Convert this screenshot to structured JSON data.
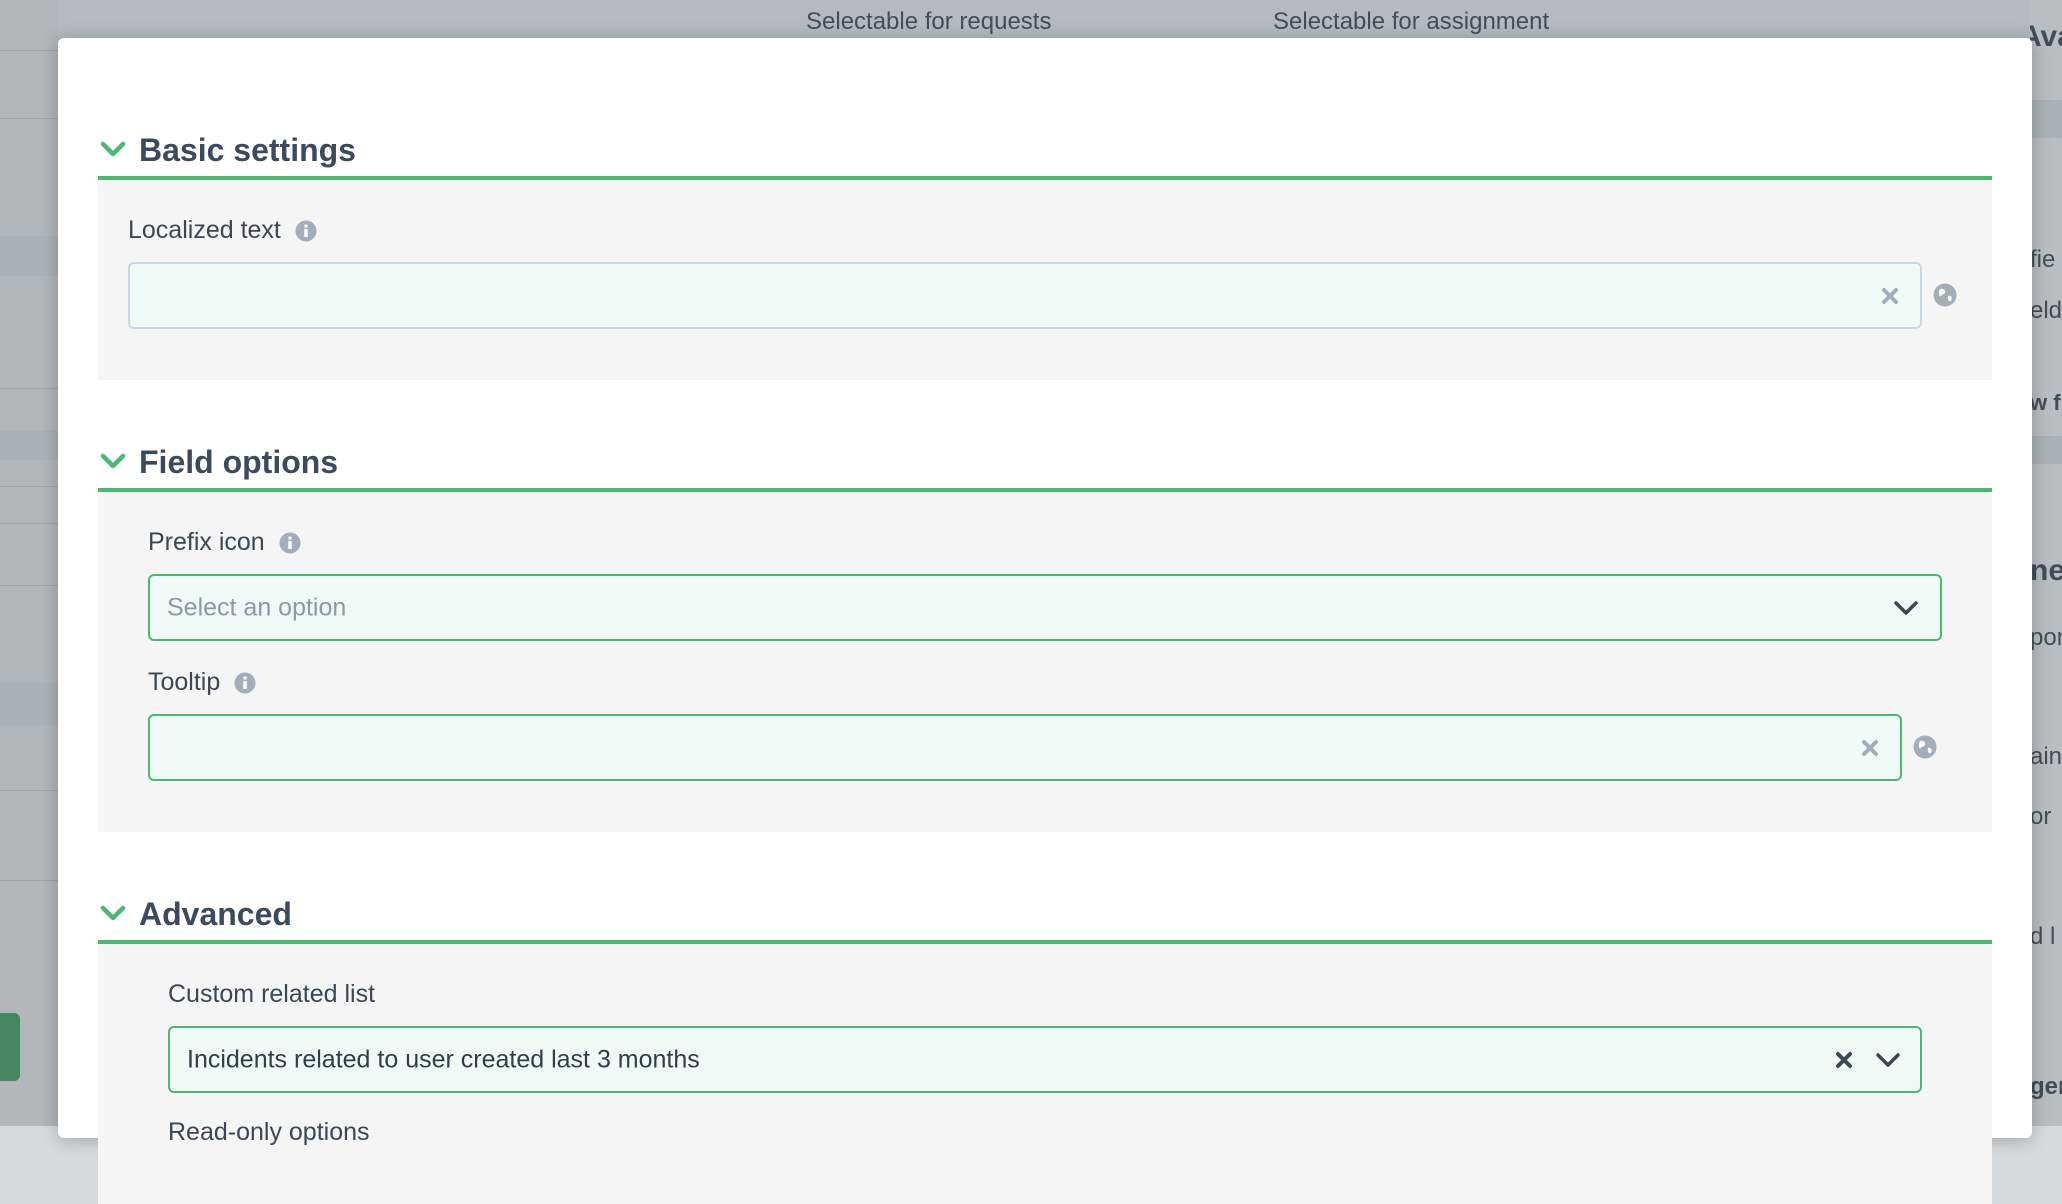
{
  "background": {
    "header_columns": [
      "Selectable for requests",
      "Selectable for assignment"
    ],
    "right_fragments": [
      "Available field",
      "fie",
      "elds",
      "w f",
      "ner",
      "pon",
      "ain",
      "or",
      "d l",
      "gen"
    ]
  },
  "modal": {
    "sections": [
      {
        "title": "Basic settings",
        "fields": [
          {
            "label": "Localized text",
            "value": "",
            "placeholder": ""
          }
        ]
      },
      {
        "title": "Field options",
        "fields": [
          {
            "label": "Prefix icon",
            "value": "",
            "placeholder": "Select an option"
          },
          {
            "label": "Tooltip",
            "value": "",
            "placeholder": ""
          }
        ]
      },
      {
        "title": "Advanced",
        "fields": [
          {
            "label": "Custom related list",
            "value": "Incidents related to user created last 3 months",
            "placeholder": ""
          }
        ],
        "next_label_partial": "Read-only options"
      }
    ]
  },
  "colors": {
    "accent_green": "#4cb873",
    "section_title": "#3b4a5c",
    "input_bg": "#effaf7",
    "icon_gray": "#a4aebb"
  },
  "icons": [
    "chevron-down-icon",
    "info-icon",
    "clear-icon",
    "globe-icon"
  ]
}
